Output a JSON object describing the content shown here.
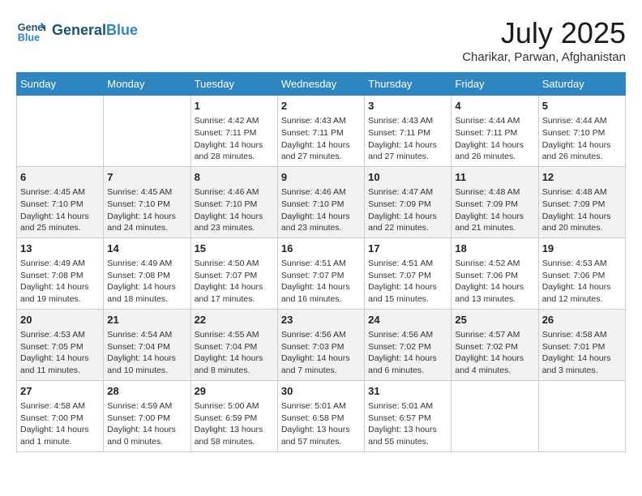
{
  "logo": {
    "line1": "General",
    "line2": "Blue"
  },
  "title": "July 2025",
  "location": "Charikar, Parwan, Afghanistan",
  "days_of_week": [
    "Sunday",
    "Monday",
    "Tuesday",
    "Wednesday",
    "Thursday",
    "Friday",
    "Saturday"
  ],
  "weeks": [
    [
      {
        "day": "",
        "detail": ""
      },
      {
        "day": "",
        "detail": ""
      },
      {
        "day": "1",
        "detail": "Sunrise: 4:42 AM\nSunset: 7:11 PM\nDaylight: 14 hours and 28 minutes."
      },
      {
        "day": "2",
        "detail": "Sunrise: 4:43 AM\nSunset: 7:11 PM\nDaylight: 14 hours and 27 minutes."
      },
      {
        "day": "3",
        "detail": "Sunrise: 4:43 AM\nSunset: 7:11 PM\nDaylight: 14 hours and 27 minutes."
      },
      {
        "day": "4",
        "detail": "Sunrise: 4:44 AM\nSunset: 7:11 PM\nDaylight: 14 hours and 26 minutes."
      },
      {
        "day": "5",
        "detail": "Sunrise: 4:44 AM\nSunset: 7:10 PM\nDaylight: 14 hours and 26 minutes."
      }
    ],
    [
      {
        "day": "6",
        "detail": "Sunrise: 4:45 AM\nSunset: 7:10 PM\nDaylight: 14 hours and 25 minutes."
      },
      {
        "day": "7",
        "detail": "Sunrise: 4:45 AM\nSunset: 7:10 PM\nDaylight: 14 hours and 24 minutes."
      },
      {
        "day": "8",
        "detail": "Sunrise: 4:46 AM\nSunset: 7:10 PM\nDaylight: 14 hours and 23 minutes."
      },
      {
        "day": "9",
        "detail": "Sunrise: 4:46 AM\nSunset: 7:10 PM\nDaylight: 14 hours and 23 minutes."
      },
      {
        "day": "10",
        "detail": "Sunrise: 4:47 AM\nSunset: 7:09 PM\nDaylight: 14 hours and 22 minutes."
      },
      {
        "day": "11",
        "detail": "Sunrise: 4:48 AM\nSunset: 7:09 PM\nDaylight: 14 hours and 21 minutes."
      },
      {
        "day": "12",
        "detail": "Sunrise: 4:48 AM\nSunset: 7:09 PM\nDaylight: 14 hours and 20 minutes."
      }
    ],
    [
      {
        "day": "13",
        "detail": "Sunrise: 4:49 AM\nSunset: 7:08 PM\nDaylight: 14 hours and 19 minutes."
      },
      {
        "day": "14",
        "detail": "Sunrise: 4:49 AM\nSunset: 7:08 PM\nDaylight: 14 hours and 18 minutes."
      },
      {
        "day": "15",
        "detail": "Sunrise: 4:50 AM\nSunset: 7:07 PM\nDaylight: 14 hours and 17 minutes."
      },
      {
        "day": "16",
        "detail": "Sunrise: 4:51 AM\nSunset: 7:07 PM\nDaylight: 14 hours and 16 minutes."
      },
      {
        "day": "17",
        "detail": "Sunrise: 4:51 AM\nSunset: 7:07 PM\nDaylight: 14 hours and 15 minutes."
      },
      {
        "day": "18",
        "detail": "Sunrise: 4:52 AM\nSunset: 7:06 PM\nDaylight: 14 hours and 13 minutes."
      },
      {
        "day": "19",
        "detail": "Sunrise: 4:53 AM\nSunset: 7:06 PM\nDaylight: 14 hours and 12 minutes."
      }
    ],
    [
      {
        "day": "20",
        "detail": "Sunrise: 4:53 AM\nSunset: 7:05 PM\nDaylight: 14 hours and 11 minutes."
      },
      {
        "day": "21",
        "detail": "Sunrise: 4:54 AM\nSunset: 7:04 PM\nDaylight: 14 hours and 10 minutes."
      },
      {
        "day": "22",
        "detail": "Sunrise: 4:55 AM\nSunset: 7:04 PM\nDaylight: 14 hours and 8 minutes."
      },
      {
        "day": "23",
        "detail": "Sunrise: 4:56 AM\nSunset: 7:03 PM\nDaylight: 14 hours and 7 minutes."
      },
      {
        "day": "24",
        "detail": "Sunrise: 4:56 AM\nSunset: 7:02 PM\nDaylight: 14 hours and 6 minutes."
      },
      {
        "day": "25",
        "detail": "Sunrise: 4:57 AM\nSunset: 7:02 PM\nDaylight: 14 hours and 4 minutes."
      },
      {
        "day": "26",
        "detail": "Sunrise: 4:58 AM\nSunset: 7:01 PM\nDaylight: 14 hours and 3 minutes."
      }
    ],
    [
      {
        "day": "27",
        "detail": "Sunrise: 4:58 AM\nSunset: 7:00 PM\nDaylight: 14 hours and 1 minute."
      },
      {
        "day": "28",
        "detail": "Sunrise: 4:59 AM\nSunset: 7:00 PM\nDaylight: 14 hours and 0 minutes."
      },
      {
        "day": "29",
        "detail": "Sunrise: 5:00 AM\nSunset: 6:59 PM\nDaylight: 13 hours and 58 minutes."
      },
      {
        "day": "30",
        "detail": "Sunrise: 5:01 AM\nSunset: 6:58 PM\nDaylight: 13 hours and 57 minutes."
      },
      {
        "day": "31",
        "detail": "Sunrise: 5:01 AM\nSunset: 6:57 PM\nDaylight: 13 hours and 55 minutes."
      },
      {
        "day": "",
        "detail": ""
      },
      {
        "day": "",
        "detail": ""
      }
    ]
  ]
}
